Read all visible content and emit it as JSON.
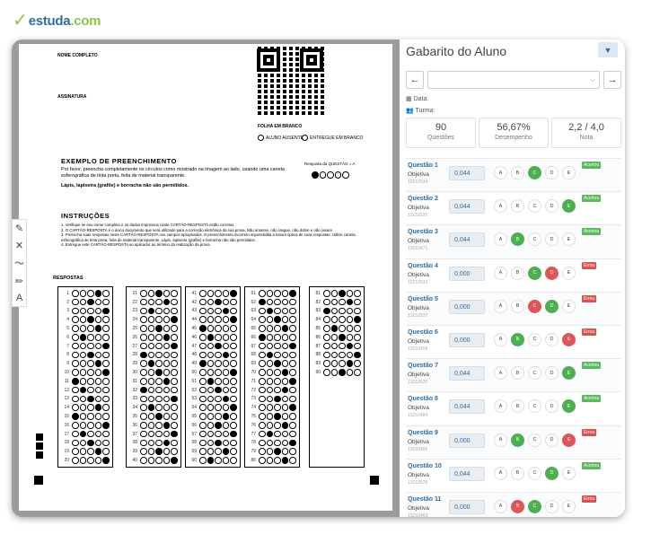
{
  "logo": {
    "brand": "estuda",
    "tld": ".com"
  },
  "sheet": {
    "nome": "NOME COMPLETO",
    "assinatura": "ASSINATURA",
    "folha_branco": "FOLHA EM BRANCO",
    "aluno_ausente": "ALUNO AUSENTE",
    "entregue_branco": "ENTREGUE EM BRANCO",
    "exemplo_title": "EXEMPLO DE PREENCHIMENTO",
    "exemplo_text1": "Por favor, preencha completamente os círculos como mostrado na imagem ao lado, usando uma caneta esferográfica de tinta preta, feita de material transparente.",
    "exemplo_text2": "Lápis, lapiseira (grafite) e borracha não são permitidos.",
    "resposta_q": "Resposta da QUESTÃO = A",
    "instrucoes_title": "INSTRUÇÕES",
    "inst1": "1. Verifique se seu nome completo e os dados impressos neste CARTÃO-RESPOSTA estão corretos.",
    "inst2": "2. O CARTÃO-RESPOSTA é o único documento que será utilizado para a correção eletrônica da sua prova. Não amasse, não rasgue, não dobre e não rasure.",
    "inst3": "3. Preencha suas respostas neste CARTÃO-RESPOSTA nos campos apropriados. O preenchimento incorreto impossibilita a leitura óptica de suas respostas. Utilize caneta esferográfica de tinta preta, feita de material transparente. Lápis, lapiseira (grafite) e borracha não são permitidos.",
    "inst4": "4. Entregue este CARTÃO-RESPOSTA ao aplicador ao término da realização da prova.",
    "respostas": "RESPOSTAS"
  },
  "panel": {
    "title": "Gabarito do Aluno",
    "data_label": "Data:",
    "turma_label": "Turma:",
    "stats": [
      {
        "value": "90",
        "label": "Questões"
      },
      {
        "value": "56,67%",
        "label": "Desempenho"
      },
      {
        "value": "2,2 / 4,0",
        "label": "Nota"
      }
    ],
    "options": [
      "A",
      "B",
      "C",
      "D",
      "E"
    ],
    "questions": [
      {
        "label": "Questão 1",
        "type": "Objetiva",
        "id": "13210534",
        "value": "0,044",
        "marks": {
          "C": "g"
        },
        "status": "Acertou",
        "ok": true
      },
      {
        "label": "Questão 2",
        "type": "Objetiva",
        "id": "13210526",
        "value": "0,044",
        "marks": {
          "E": "g"
        },
        "status": "Acertou",
        "ok": true
      },
      {
        "label": "Questão 3",
        "type": "Objetiva",
        "id": "13210471",
        "value": "0,044",
        "marks": {
          "B": "g"
        },
        "status": "Acertou",
        "ok": true
      },
      {
        "label": "Questão 4",
        "type": "Objetiva",
        "id": "13210532",
        "value": "0,000",
        "marks": {
          "C": "g",
          "D": "r"
        },
        "status": "Errou",
        "ok": false
      },
      {
        "label": "Questão 5",
        "type": "Objetiva",
        "id": "13210237",
        "value": "0,000",
        "marks": {
          "C": "r",
          "D": "g"
        },
        "status": "Errou",
        "ok": false
      },
      {
        "label": "Questão 6",
        "type": "Objetiva",
        "id": "13210458",
        "value": "0,000",
        "marks": {
          "B": "g",
          "E": "r"
        },
        "status": "Errou",
        "ok": false
      },
      {
        "label": "Questão 7",
        "type": "Objetiva",
        "id": "13210520",
        "value": "0,044",
        "marks": {
          "E": "g"
        },
        "status": "Acertou",
        "ok": true
      },
      {
        "label": "Questão 8",
        "type": "Objetiva",
        "id": "13210484",
        "value": "0,044",
        "marks": {
          "E": "g"
        },
        "status": "Acertou",
        "ok": true
      },
      {
        "label": "Questão 9",
        "type": "Objetiva",
        "id": "13210486",
        "value": "0,000",
        "marks": {
          "B": "g",
          "E": "r"
        },
        "status": "Errou",
        "ok": false
      },
      {
        "label": "Questão 10",
        "type": "Objetiva",
        "id": "13210529",
        "value": "0,044",
        "marks": {
          "D": "g"
        },
        "status": "Acertou",
        "ok": true
      },
      {
        "label": "Questão 11",
        "type": "Objetiva",
        "id": "13210463",
        "value": "0,000",
        "marks": {
          "B": "r",
          "C": "g"
        },
        "status": "Errou",
        "ok": false
      }
    ]
  }
}
